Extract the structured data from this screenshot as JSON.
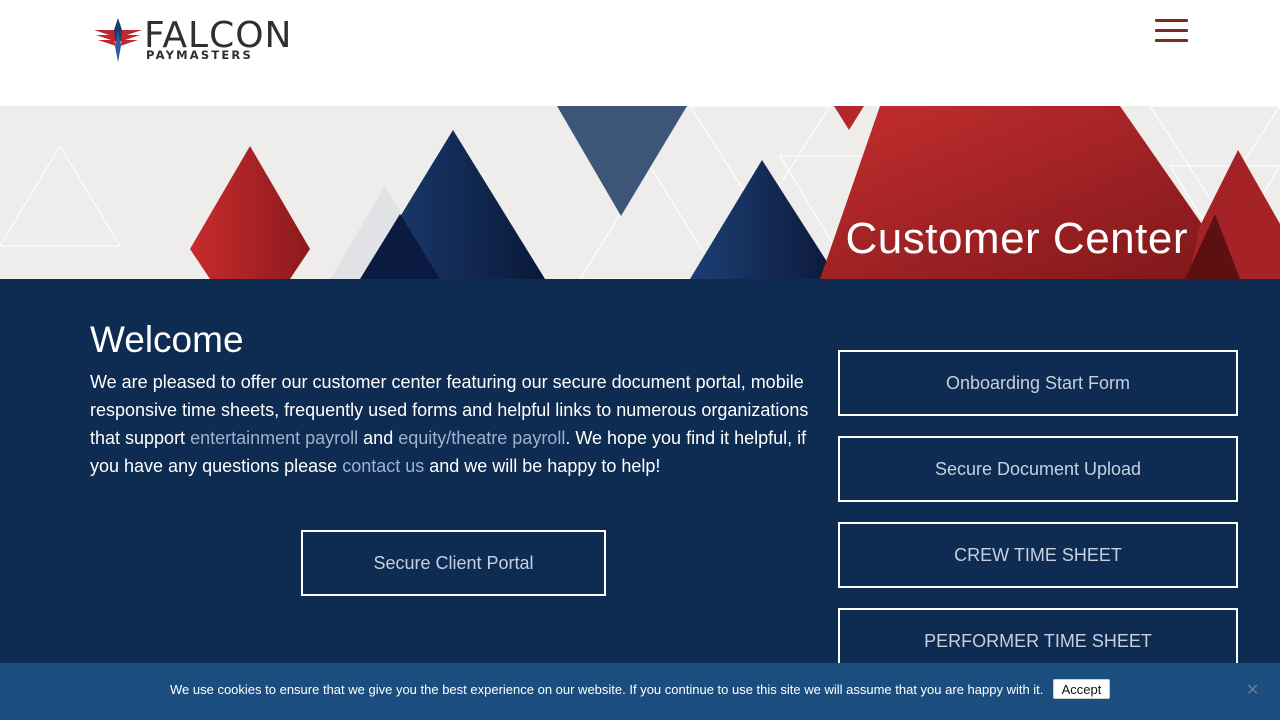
{
  "header": {
    "logo_word": "FALCON",
    "logo_sub": "PAYMASTERS",
    "menu_icon": "hamburger-menu-icon"
  },
  "hero": {
    "title": "Customer Center"
  },
  "welcome": {
    "title": "Welcome",
    "text_1": "We are pleased to offer our customer center featuring our secure document portal, mobile responsive time sheets, frequently used forms and helpful links to numerous organizations that support ",
    "link_entertainment": "entertainment payroll",
    "text_2": " and ",
    "link_equity": "equity/theatre payroll",
    "text_3": ". We hope you find it helpful, if you have any questions please ",
    "link_contact": "contact us",
    "text_4": " and we will be happy to help!",
    "portal_button": "Secure Client Portal"
  },
  "sidebar_buttons": [
    {
      "label": "Onboarding Start Form"
    },
    {
      "label": "Secure Document Upload"
    },
    {
      "label": "CREW TIME SHEET"
    },
    {
      "label": "PERFORMER TIME SHEET"
    }
  ],
  "cookie": {
    "text": "We use cookies to ensure that we give you the best experience on our website. If you continue to use this site we will assume that you are happy with it.",
    "accept": "Accept",
    "close": "✕"
  },
  "colors": {
    "navy": "#0e2b52",
    "brand_red": "#b5282a",
    "cookie_bar": "#1b4e7f",
    "link": "#9fb1cc"
  }
}
